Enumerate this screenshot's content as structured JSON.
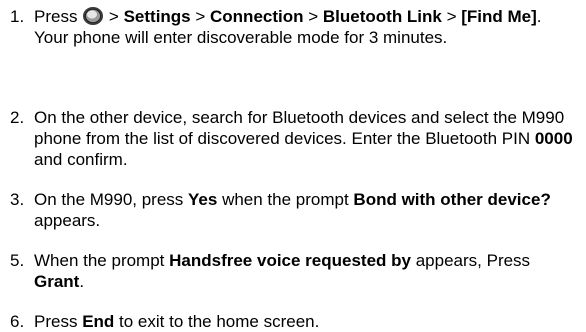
{
  "steps": [
    {
      "number": "1.",
      "parts": {
        "t1": "Press",
        "icon": "menu-key-icon",
        "t2": " > ",
        "b1": "Settings",
        "t3": " > ",
        "b2": "Connection",
        "t4": " > ",
        "b3": "Bluetooth Link",
        "t5": " > ",
        "b4": "[Find Me]",
        "t6": ". Your phone will enter discoverable mode for 3 minutes."
      }
    },
    {
      "number": "2.",
      "parts": {
        "t1": "On the other device, search for Bluetooth devices and select the M990 phone from the list of discovered devices. Enter the Bluetooth PIN ",
        "b1": "0000",
        "t2": " and confirm."
      }
    },
    {
      "number": "3.",
      "parts": {
        "t1": "On the M990, press ",
        "b1": "Yes",
        "t2": " when the prompt ",
        "b2": "Bond with other device?",
        "t3": " appears."
      }
    },
    {
      "number": "5.",
      "parts": {
        "t1": "When the prompt ",
        "b1": "Handsfree voice requested by",
        "t2": " appears, Press ",
        "b2": "Grant",
        "t3": "."
      }
    },
    {
      "number": "6.",
      "parts": {
        "t1": "Press ",
        "b1": "End",
        "t2": " to exit to the home screen."
      }
    }
  ]
}
